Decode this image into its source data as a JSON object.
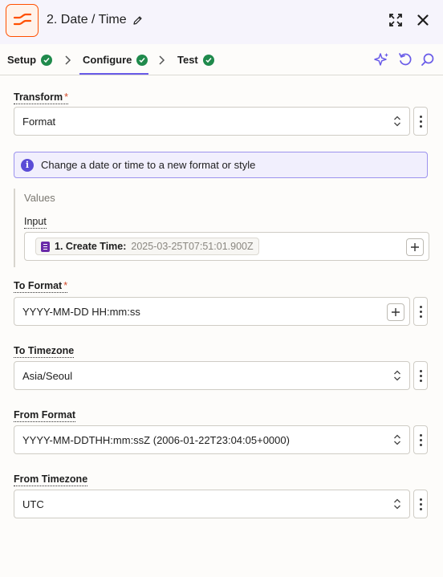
{
  "header": {
    "title": "2. Date / Time",
    "brand_color": "#ff4f00"
  },
  "tabs": [
    {
      "label": "Setup",
      "status": "complete"
    },
    {
      "label": "Configure",
      "status": "complete",
      "active": true
    },
    {
      "label": "Test",
      "status": "complete"
    }
  ],
  "form": {
    "transform": {
      "label": "Transform",
      "value": "Format"
    },
    "info_text": "Change a date or time to a new format or style",
    "values": {
      "title": "Values",
      "input_label": "Input",
      "input_pill": {
        "name": "1. Create Time:",
        "value": "2025-03-25T07:51:01.900Z"
      }
    },
    "to_format": {
      "label": "To Format",
      "value": "YYYY-MM-DD HH:mm:ss"
    },
    "to_timezone": {
      "label": "To Timezone",
      "value": "Asia/Seoul"
    },
    "from_format": {
      "label": "From Format",
      "value": "YYYY-MM-DDTHH:mm:ssZ (2006-01-22T23:04:05+0000)"
    },
    "from_timezone": {
      "label": "From Timezone",
      "value": "UTC"
    }
  },
  "colors": {
    "accent": "#695be8",
    "success": "#1f8a4c",
    "required": "#d24a2a"
  },
  "icons": [
    "zap-step-icon",
    "edit-pencil-icon",
    "expand-icon",
    "close-icon",
    "ai-sparkle-icon",
    "undo-icon",
    "search-icon",
    "info-icon",
    "more-vertical-icon",
    "updown-icon",
    "plus-icon",
    "doc-icon"
  ]
}
